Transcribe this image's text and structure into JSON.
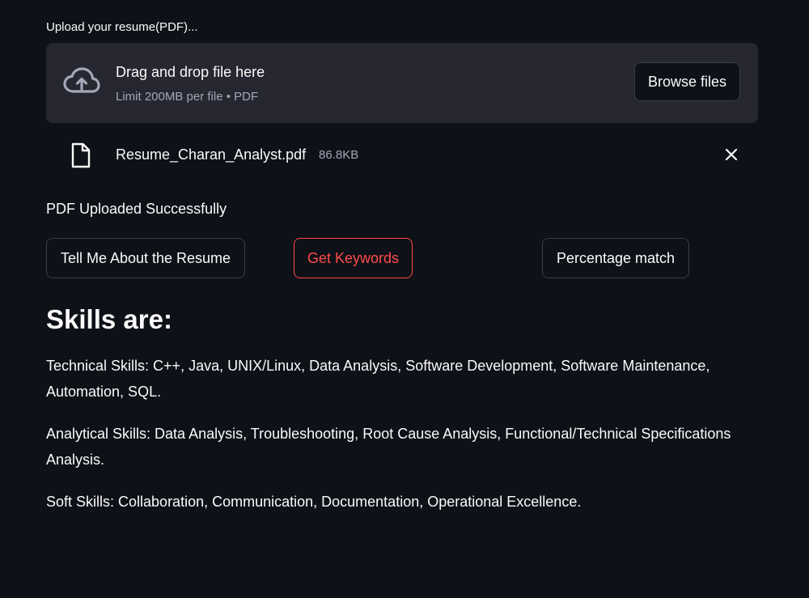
{
  "uploader": {
    "label": "Upload your resume(PDF)...",
    "drop_title": "Drag and drop file here",
    "drop_limit": "Limit 200MB per file • PDF",
    "browse_label": "Browse files",
    "icon": "cloud-upload-icon"
  },
  "file": {
    "name": "Resume_Charan_Analyst.pdf",
    "size": "86.8KB",
    "icon": "file-icon",
    "remove_icon": "close-icon"
  },
  "status": "PDF Uploaded Successfully",
  "actions": {
    "about_label": "Tell Me About the Resume",
    "keywords_label": "Get Keywords",
    "match_label": "Percentage match"
  },
  "result": {
    "heading": "Skills are:",
    "technical": "Technical Skills: C++, Java, UNIX/Linux, Data Analysis, Software Development, Software Maintenance, Automation, SQL.",
    "analytical": "Analytical Skills: Data Analysis, Troubleshooting, Root Cause Analysis, Functional/Technical Specifications Analysis.",
    "soft": "Soft Skills: Collaboration, Communication, Documentation, Operational Excellence."
  },
  "colors": {
    "background": "#0e1117",
    "dropzone": "#262730",
    "accent": "#ff4b4b",
    "muted_text": "#a3a8b8"
  }
}
